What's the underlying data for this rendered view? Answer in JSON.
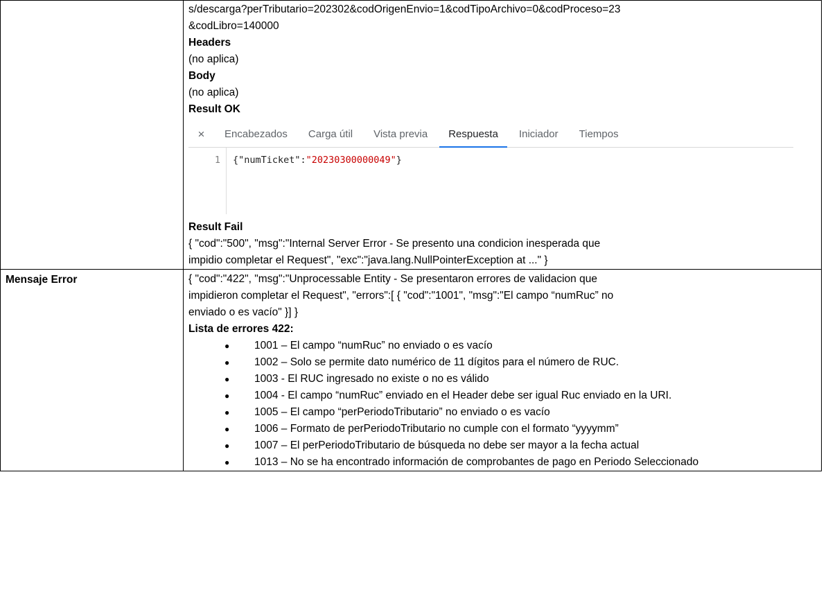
{
  "request": {
    "url_line1": "s/descarga?perTributario=202302&codOrigenEnvio=1&codTipoArchivo=0&codProceso=23",
    "url_line2": "&codLibro=140000",
    "headers_title": "Headers",
    "headers_value": "(no aplica)",
    "body_title": "Body",
    "body_value": "(no aplica)",
    "result_ok_title": "Result OK",
    "result_fail_title": "Result Fail",
    "result_fail_line1": "{ \"cod\":\"500\", \"msg\":\"Internal Server Error - Se presento una condicion inesperada que",
    "result_fail_line2": "impidio completar el Request\", \"exc\":\"java.lang.NullPointerException at ...\" }"
  },
  "devtools": {
    "close_glyph": "×",
    "tabs": [
      "Encabezados",
      "Carga útil",
      "Vista previa",
      "Respuesta",
      "Iniciador",
      "Tiempos"
    ],
    "active_tab": "Respuesta",
    "line_number": "1",
    "code_prefix": "{\"numTicket\":",
    "code_value": "\"20230300000049\"",
    "code_suffix": "}"
  },
  "error_section": {
    "label": "Mensaje Error",
    "message_line1": "{ \"cod\":\"422\", \"msg\":\"Unprocessable Entity - Se presentaron errores de validacion que",
    "message_line2": "impidieron completar el Request\", \"errors\":[ { \"cod\":\"1001\", \"msg\":\"El campo “numRuc” no",
    "message_line3": "enviado o es vacío\" }] }",
    "list_title": "Lista de errores 422:",
    "errors": [
      "1001 – El campo “numRuc” no enviado o es vacío",
      "1002 – Solo se permite dato numérico de 11 dígitos para el número de RUC.",
      "1003 - El RUC ingresado no existe o no es válido",
      "1004 - El campo “numRuc” enviado en el Header debe ser igual Ruc enviado en la URI.",
      "1005 – El campo “perPeriodoTributario” no enviado o es vacío",
      "1006 – Formato de perPeriodoTributario no cumple con el formato “yyyymm”",
      "1007 – El perPeriodoTributario de búsqueda no debe ser mayor a la fecha actual",
      "1013 – No se ha encontrado información de comprobantes de pago en Periodo Seleccionado"
    ]
  }
}
